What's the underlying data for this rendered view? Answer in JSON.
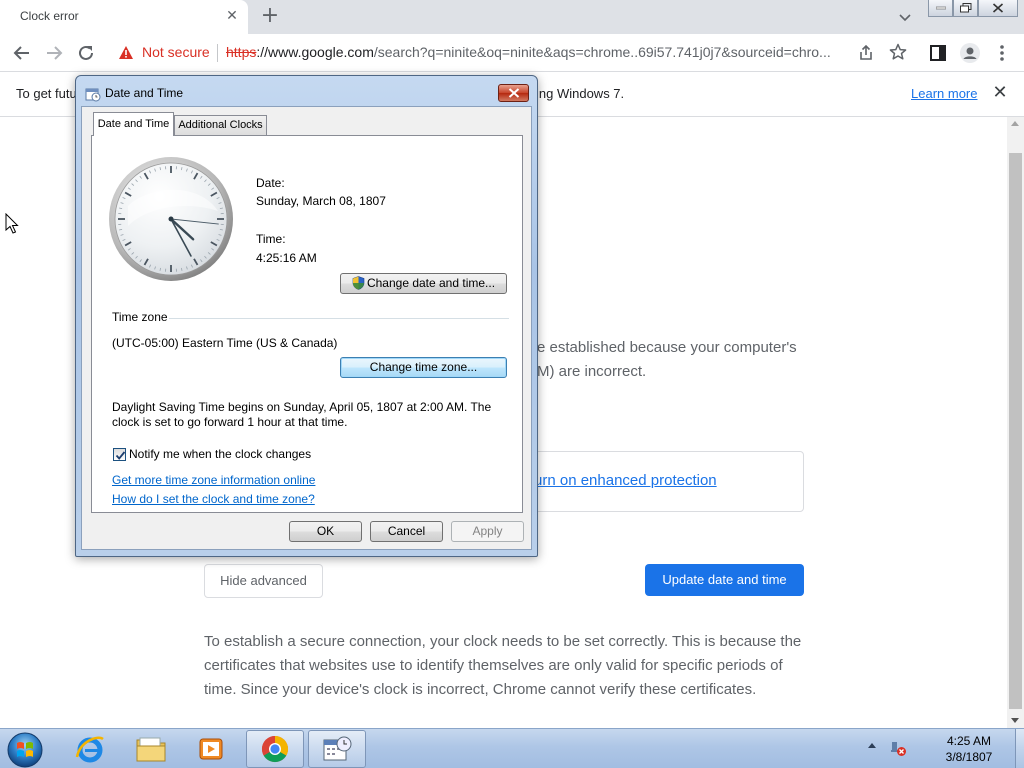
{
  "browser": {
    "tab": {
      "title": "Clock error",
      "close_glyph": "✕"
    },
    "new_tab_glyph": "+",
    "omnibox": {
      "security_label": "Not secure",
      "url_scheme": "https",
      "url_host": "://www.google.com",
      "url_rest": "/search?q=ninite&oq=ninite&aqs=chrome..69i57.741j0j7&sourceid=chro..."
    },
    "infobar": {
      "text_start": "To get futu",
      "text_end": "ing Windows 7.",
      "learn_more": "Learn more",
      "close_glyph": "✕"
    },
    "icons": [
      "back-icon",
      "forward-icon",
      "reload-icon",
      "share-icon",
      "star-icon",
      "side-panel-icon",
      "profile-icon",
      "menu-icon"
    ]
  },
  "page": {
    "error_line1": "e established because your computer's",
    "error_line2": "M) are incorrect.",
    "enhanced_protection_link": "urn on enhanced protection",
    "hide_advanced": "Hide advanced",
    "update_button": "Update date and time",
    "explanation": "To establish a secure connection, your clock needs to be set correctly. This is because the certificates that websites use to identify themselves are only valid for specific periods of time. Since your device's clock is incorrect, Chrome cannot verify these certificates."
  },
  "dialog": {
    "title": "Date and Time",
    "tabs": [
      "Date and Time",
      "Additional Clocks"
    ],
    "date_label": "Date:",
    "date_value": "Sunday, March 08, 1807",
    "time_label": "Time:",
    "time_value": "4:25:16 AM",
    "change_datetime_button": "Change date and time...",
    "timezone_header": "Time zone",
    "timezone_value": "(UTC-05:00) Eastern Time (US & Canada)",
    "change_timezone_button": "Change time zone...",
    "dst_line1": "Daylight Saving Time begins on Sunday, April 05, 1807 at 2:00 AM. The",
    "dst_line2": "clock is set to go forward 1 hour at that time.",
    "notify_label": "Notify me when the clock changes",
    "notify_checked": true,
    "link_more_info": "Get more time zone information online",
    "link_how_to": "How do I set the clock and time zone?",
    "ok": "OK",
    "cancel": "Cancel",
    "apply": "Apply",
    "clock": {
      "hour": 4,
      "minute": 25,
      "second": 16
    }
  },
  "taskbar": {
    "pinned": [
      "internet-explorer-icon",
      "file-explorer-icon",
      "media-player-icon",
      "chrome-icon",
      "date-time-icon"
    ],
    "clock_time": "4:25 AM",
    "clock_date": "3/8/1807"
  },
  "colors": {
    "chrome_blue": "#1a73e8",
    "not_secure_red": "#d93025",
    "tabstrip": "#dee1e6",
    "taskbar_blue": "#aec6e6"
  }
}
